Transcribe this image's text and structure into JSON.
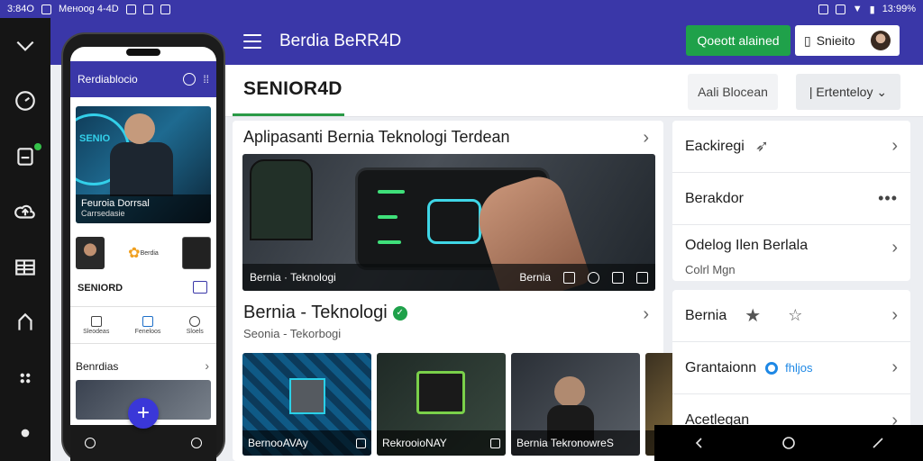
{
  "status_bar": {
    "time": "3:84O",
    "app_name": "Менооg 4-4D",
    "battery": "13:99%"
  },
  "header": {
    "title": "Berdia BeRR4D",
    "primary_button": "Qoeott alained",
    "secondary_button": "Snieito"
  },
  "subheader": {
    "brand": "SENIOR4D",
    "search_label": "Aali Blocean",
    "sort_label": "| Ertenteloy"
  },
  "main": {
    "card_title": "Aplipasanti Bernia Teknologi Terdean",
    "hero_caption_left": "Bernia · Teknologi",
    "hero_caption_right": "Bernia",
    "section_title": "Bernia - Teknologi",
    "section_badge": "✓",
    "section_subtitle": "Seonia - Tekorbogi",
    "thumbnails": [
      {
        "caption": "BernooAVAy"
      },
      {
        "caption": "RekrooioNAY"
      },
      {
        "caption": "Bernia TekronowreS"
      },
      {
        "caption": ""
      }
    ]
  },
  "right_panel": {
    "group1": [
      {
        "label": "Eackiregi",
        "action": "chevron"
      },
      {
        "label": "Berakdor",
        "action": "more"
      },
      {
        "label": "Odelog Ilen Berlala",
        "sublabel": "Colrl Mgn",
        "action": "chevron"
      }
    ],
    "group2": [
      {
        "label": "Bernia",
        "action": "chevron"
      },
      {
        "label": "Grantaionn",
        "tag": "fhljos",
        "action": "chevron"
      },
      {
        "label": "Acetlegan",
        "action": "chevron"
      }
    ]
  },
  "phone": {
    "app_title": "Rerdiablocio",
    "hero_title": "Feuroia Dorrsal",
    "hero_subtitle": "Carrsedasie",
    "hero_brand": "SENIO",
    "row_label": "Berdia",
    "brand": "SENIORD",
    "nav": [
      "Sleodeas",
      "Feneloos",
      "Sloels"
    ],
    "section_title": "Benrdias"
  },
  "colors": {
    "header": "#3a37a8",
    "accent_green": "#1fa14a",
    "rail": "#151515",
    "link_blue": "#1e88e5"
  }
}
